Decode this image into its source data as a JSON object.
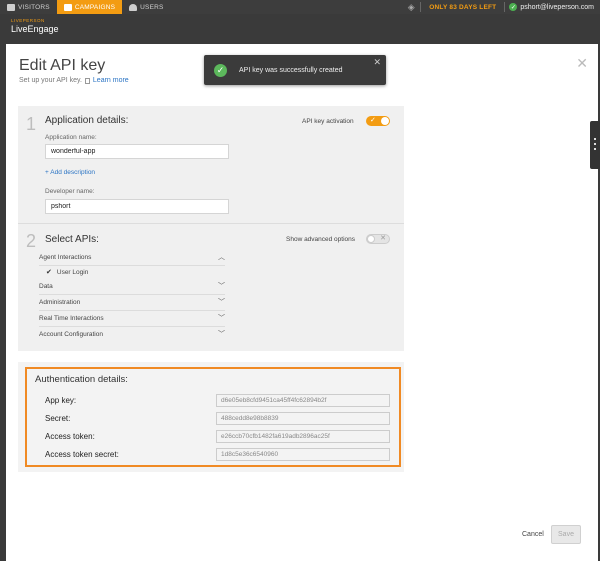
{
  "topbar": {
    "tabs": [
      {
        "label": "VISITORS",
        "icon": "chat-icon",
        "active": false
      },
      {
        "label": "CAMPAIGNS",
        "icon": "tag-icon",
        "active": true
      },
      {
        "label": "USERS",
        "icon": "user-icon",
        "active": false
      }
    ],
    "trial_label": "ONLY 83 DAYS LEFT",
    "user_email": "pshort@liveperson.com",
    "accent_color": "#f39c12"
  },
  "logo": {
    "small": "LIVEPERSON",
    "big": "LiveEngage"
  },
  "modal": {
    "title": "Edit API key",
    "subtitle": "Set up your API key.",
    "learn_more": "Learn more"
  },
  "toast": {
    "message": "API key was successfully created"
  },
  "app_details": {
    "step": "1",
    "title": "Application details:",
    "activation_label": "API key activation",
    "app_name_label": "Application name:",
    "app_name_value": "wonderful-app",
    "add_description": "+ Add description",
    "developer_label": "Developer name:",
    "developer_value": "pshort"
  },
  "select_apis": {
    "step": "2",
    "title": "Select APIs:",
    "advanced_label": "Show advanced options",
    "groups": [
      {
        "name": "Agent Interactions",
        "expanded": true
      },
      {
        "name": "Data",
        "expanded": false
      },
      {
        "name": "Administration",
        "expanded": false
      },
      {
        "name": "Real Time Interactions",
        "expanded": false
      },
      {
        "name": "Account Configuration",
        "expanded": false
      }
    ],
    "selected_sub": "User Login"
  },
  "auth": {
    "title": "Authentication details:",
    "rows": [
      {
        "label": "App key:",
        "value": "d6e05eb8cfd9451ca45ff4fc62894b2f"
      },
      {
        "label": "Secret:",
        "value": "488cedd8e98b8839"
      },
      {
        "label": "Access token:",
        "value": "e26ccb70cfb1482fa619adb2896ac25f"
      },
      {
        "label": "Access token secret:",
        "value": "1d8c5e36c6540960"
      }
    ],
    "highlight_color": "#f08a24"
  },
  "footer": {
    "cancel": "Cancel",
    "save": "Save"
  }
}
